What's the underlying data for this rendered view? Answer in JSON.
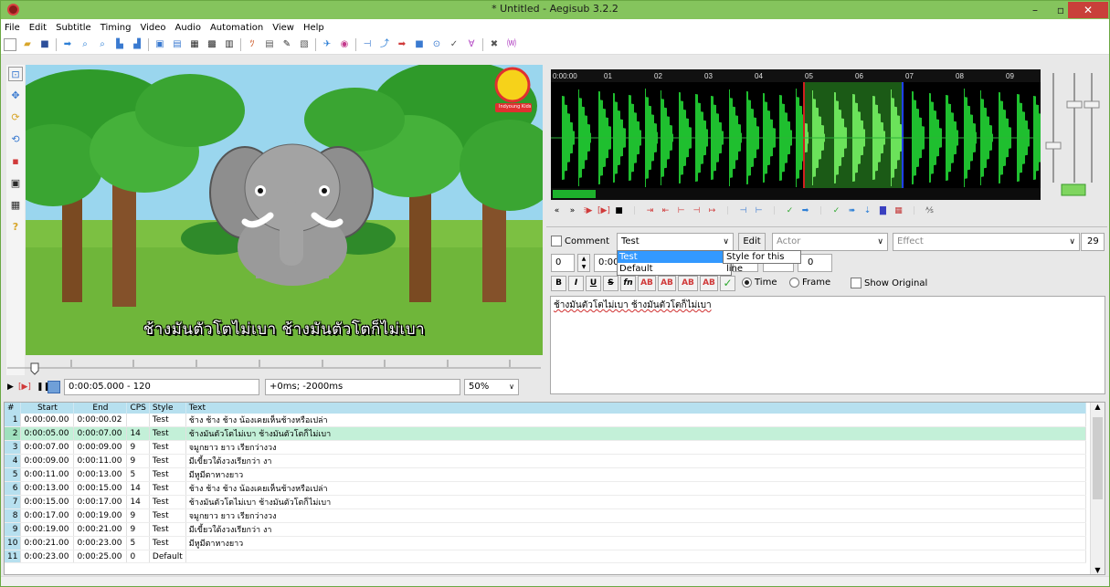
{
  "window": {
    "title": "* Untitled - Aegisub 3.2.2",
    "minimize": "–",
    "maximize": "▫",
    "close": "✕"
  },
  "menu": [
    "File",
    "Edit",
    "Subtitle",
    "Timing",
    "Video",
    "Audio",
    "Automation",
    "View",
    "Help"
  ],
  "video": {
    "burned_subtitle": "ช้างมันตัวโตไม่เบา ช้างมันตัวโตก็ไม่เบา",
    "channel_badge": "Indyoung Kids",
    "time_frame": "0:00:05.000 - 120",
    "offset": "+0ms; -2000ms",
    "zoom": "50%"
  },
  "audio": {
    "time_labels": [
      "0:00:00",
      "01",
      "02",
      "03",
      "04",
      "05",
      "06",
      "07",
      "08",
      "09"
    ]
  },
  "edit": {
    "comment_label": "Comment",
    "style_value": "Test",
    "edit_button": "Edit",
    "actor_placeholder": "Actor",
    "effect_placeholder": "Effect",
    "margin_value": "29",
    "layer": "0",
    "start_time": "0:00",
    "margin_fields": [
      "0"
    ],
    "dropdown_options": [
      "Test",
      "Default"
    ],
    "tooltip": "Style for this line",
    "format_buttons": [
      "B",
      "I",
      "U",
      "S",
      "fn",
      "AB",
      "AB",
      "AB",
      "AB"
    ],
    "time_label": "Time",
    "frame_label": "Frame",
    "show_original_label": "Show Original",
    "text": "ช้างมันตัวโตไม่เบา ช้างมันตัวโตก็ไม่เบา"
  },
  "grid": {
    "headers": [
      "#",
      "Start",
      "End",
      "CPS",
      "Style",
      "Text"
    ],
    "rows": [
      {
        "n": "1",
        "start": "0:00:00.00",
        "end": "0:00:00.02",
        "cps": "",
        "style": "Test",
        "text": "ช้าง ช้าง ช้าง น้องเคยเห็นช้างหรือเปล่า"
      },
      {
        "n": "2",
        "start": "0:00:05.00",
        "end": "0:00:07.00",
        "cps": "14",
        "style": "Test",
        "text": "ช้างมันตัวโตไม่เบา ช้างมันตัวโตก็ไม่เบา"
      },
      {
        "n": "3",
        "start": "0:00:07.00",
        "end": "0:00:09.00",
        "cps": "9",
        "style": "Test",
        "text": "จมูกยาว ยาว เรียกว่างวง"
      },
      {
        "n": "4",
        "start": "0:00:09.00",
        "end": "0:00:11.00",
        "cps": "9",
        "style": "Test",
        "text": "มีเขี้ยวใต้งวงเรียกว่า งา"
      },
      {
        "n": "5",
        "start": "0:00:11.00",
        "end": "0:00:13.00",
        "cps": "5",
        "style": "Test",
        "text": "มีหูมีตาหางยาว"
      },
      {
        "n": "6",
        "start": "0:00:13.00",
        "end": "0:00:15.00",
        "cps": "14",
        "style": "Test",
        "text": "ช้าง ช้าง ช้าง น้องเคยเห็นช้างหรือเปล่า"
      },
      {
        "n": "7",
        "start": "0:00:15.00",
        "end": "0:00:17.00",
        "cps": "14",
        "style": "Test",
        "text": "ช้างมันตัวโตไม่เบา ช้างมันตัวโตก็ไม่เบา"
      },
      {
        "n": "8",
        "start": "0:00:17.00",
        "end": "0:00:19.00",
        "cps": "9",
        "style": "Test",
        "text": "จมูกยาว ยาว เรียกว่างวง"
      },
      {
        "n": "9",
        "start": "0:00:19.00",
        "end": "0:00:21.00",
        "cps": "9",
        "style": "Test",
        "text": "มีเขี้ยวใต้งวงเรียกว่า งา"
      },
      {
        "n": "10",
        "start": "0:00:21.00",
        "end": "0:00:23.00",
        "cps": "5",
        "style": "Test",
        "text": "มีหูมีตาหางยาว"
      },
      {
        "n": "11",
        "start": "0:00:23.00",
        "end": "0:00:25.00",
        "cps": "0",
        "style": "Default",
        "text": ""
      }
    ]
  },
  "colors": {
    "titlebar": "#85c45d",
    "waveform": "#1fbf2f",
    "selection": "#5fdc4f",
    "active_row": "#c3f0d8",
    "grid_header": "#b7e0ef"
  }
}
